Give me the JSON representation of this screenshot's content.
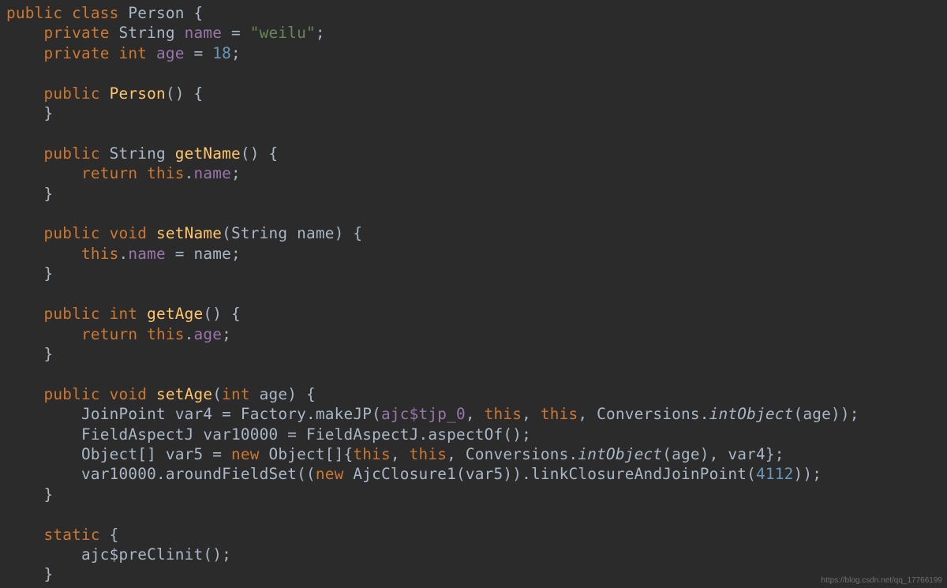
{
  "code": {
    "l1": {
      "kw1": "public",
      "kw2": "class",
      "name": "Person",
      "br": " {"
    },
    "l2": {
      "ind": "    ",
      "kw1": "private",
      "typ": "String",
      "fld": "name",
      "eq": " = ",
      "str": "\"weilu\"",
      "sc": ";"
    },
    "l3": {
      "ind": "    ",
      "kw1": "private",
      "kw2": "int",
      "fld": "age",
      "eq": " = ",
      "num": "18",
      "sc": ";"
    },
    "l4": "",
    "l5": {
      "ind": "    ",
      "kw1": "public",
      "name": "Person",
      "rest": "() {"
    },
    "l6": {
      "ind": "    ",
      "br": "}"
    },
    "l7": "",
    "l8": {
      "ind": "    ",
      "kw1": "public",
      "typ": "String",
      "name": "getName",
      "rest": "() {"
    },
    "l9": {
      "ind": "        ",
      "kw1": "return",
      "kw2": "this",
      "dot": ".",
      "fld": "name",
      "sc": ";"
    },
    "l10": {
      "ind": "    ",
      "br": "}"
    },
    "l11": "",
    "l12": {
      "ind": "    ",
      "kw1": "public",
      "kw2": "void",
      "name": "setName",
      "rest": "(String name) {"
    },
    "l13": {
      "ind": "        ",
      "kw1": "this",
      "dot": ".",
      "fld": "name",
      "rest": " = name;"
    },
    "l14": {
      "ind": "    ",
      "br": "}"
    },
    "l15": "",
    "l16": {
      "ind": "    ",
      "kw1": "public",
      "kw2": "int",
      "name": "getAge",
      "rest": "() {"
    },
    "l17": {
      "ind": "        ",
      "kw1": "return",
      "kw2": "this",
      "dot": ".",
      "fld": "age",
      "sc": ";"
    },
    "l18": {
      "ind": "    ",
      "br": "}"
    },
    "l19": "",
    "l20": {
      "ind": "    ",
      "kw1": "public",
      "kw2": "void",
      "name": "setAge",
      "op": "(",
      "kw3": "int",
      "rest": " age) {"
    },
    "l21": {
      "ind": "        ",
      "p1": "JoinPoint var4 = Factory.makeJP(",
      "fld": "ajc$tjp_0",
      "p2": ", ",
      "kw1": "this",
      "p3": ", ",
      "kw2": "this",
      "p4": ", Conversions.",
      "ital": "intObject",
      "p5": "(age));"
    },
    "l22": {
      "ind": "        ",
      "p1": "FieldAspectJ var10000 = FieldAspectJ.aspectOf();"
    },
    "l23": {
      "ind": "        ",
      "p1": "Object[] var5 = ",
      "kw1": "new",
      "p2": " Object[]{",
      "kw2": "this",
      "p3": ", ",
      "kw3": "this",
      "p4": ", Conversions.",
      "ital": "intObject",
      "p5": "(age), var4};"
    },
    "l24": {
      "ind": "        ",
      "p1": "var10000.aroundFieldSet((",
      "kw1": "new",
      "p2": " AjcClosure1(var5)).linkClosureAndJoinPoint(",
      "num": "4112",
      "p3": "));"
    },
    "l25": {
      "ind": "    ",
      "br": "}"
    },
    "l26": "",
    "l27": {
      "ind": "    ",
      "kw1": "static",
      "rest": " {"
    },
    "l28": {
      "ind": "        ",
      "p1": "ajc$preClinit();"
    },
    "l29": {
      "ind": "    ",
      "br": "}"
    }
  },
  "watermark": "https://blog.csdn.net/qq_17766199"
}
